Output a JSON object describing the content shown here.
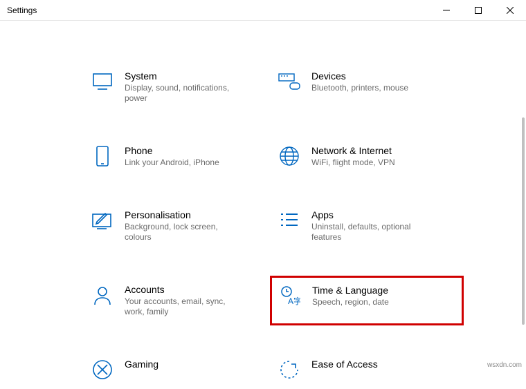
{
  "window": {
    "title": "Settings"
  },
  "categories": [
    {
      "title": "System",
      "desc": "Display, sound, notifications, power"
    },
    {
      "title": "Devices",
      "desc": "Bluetooth, printers, mouse"
    },
    {
      "title": "Phone",
      "desc": "Link your Android, iPhone"
    },
    {
      "title": "Network & Internet",
      "desc": "WiFi, flight mode, VPN"
    },
    {
      "title": "Personalisation",
      "desc": "Background, lock screen, colours"
    },
    {
      "title": "Apps",
      "desc": "Uninstall, defaults, optional features"
    },
    {
      "title": "Accounts",
      "desc": "Your accounts, email, sync, work, family"
    },
    {
      "title": "Time & Language",
      "desc": "Speech, region, date"
    },
    {
      "title": "Gaming",
      "desc": ""
    },
    {
      "title": "Ease of Access",
      "desc": ""
    }
  ],
  "watermark": "wsxdn.com"
}
